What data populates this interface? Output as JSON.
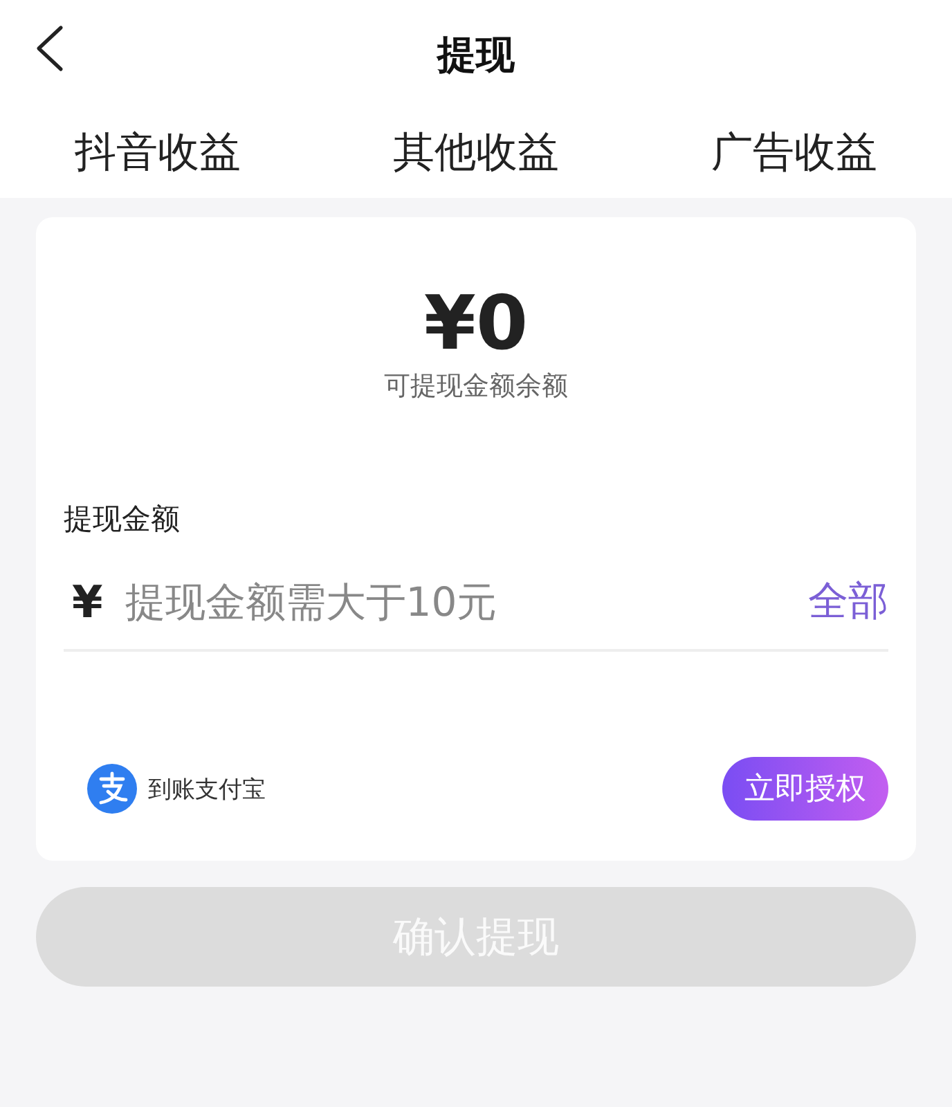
{
  "header": {
    "title": "提现"
  },
  "tabs": [
    {
      "label": "抖音收益"
    },
    {
      "label": "其他收益"
    },
    {
      "label": "广告收益"
    }
  ],
  "balance": {
    "amount": "¥0",
    "caption": "可提现金额余额"
  },
  "form": {
    "label": "提现金额",
    "currency": "¥",
    "placeholder": "提现金额需大于10元",
    "all_link": "全部"
  },
  "payout": {
    "text": "到账支付宝",
    "button": "立即授权"
  },
  "confirm": {
    "label": "确认提现",
    "disabled": true
  }
}
